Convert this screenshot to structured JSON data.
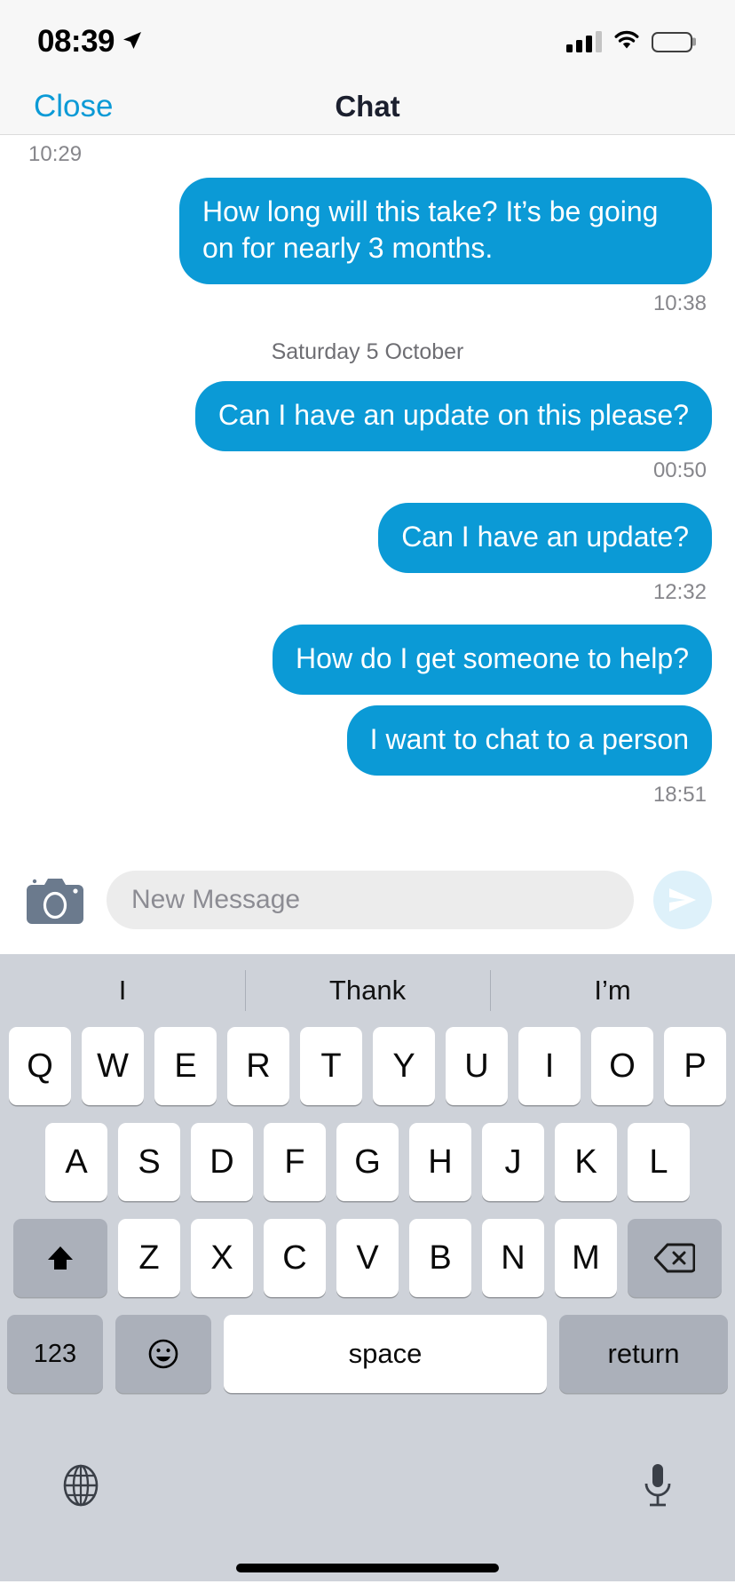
{
  "status_bar": {
    "time": "08:39",
    "location_icon": "location-arrow-icon",
    "signal_icon": "cellular-signal-icon",
    "signal_bars_filled": 3,
    "signal_bars_total": 4,
    "wifi_icon": "wifi-icon",
    "battery_icon": "battery-icon",
    "battery_level": 100
  },
  "nav": {
    "close_label": "Close",
    "title": "Chat"
  },
  "chat": {
    "accent_color": "#0b9ad6",
    "timestamp_color": "#86868b",
    "items": [
      {
        "kind": "timestamp",
        "align": "left",
        "text": "10:29"
      },
      {
        "kind": "message",
        "direction": "outgoing",
        "text": "How long will this take? It’s be going on for nearly 3 months."
      },
      {
        "kind": "timestamp",
        "align": "right",
        "text": "10:38"
      },
      {
        "kind": "day-separator",
        "text": "Saturday 5 October"
      },
      {
        "kind": "message",
        "direction": "outgoing",
        "text": "Can I have an update on this please?"
      },
      {
        "kind": "timestamp",
        "align": "right",
        "text": "00:50"
      },
      {
        "kind": "message",
        "direction": "outgoing",
        "text": "Can I have an update?"
      },
      {
        "kind": "timestamp",
        "align": "right",
        "text": "12:32"
      },
      {
        "kind": "message",
        "direction": "outgoing",
        "text": "How do I get someone to help?"
      },
      {
        "kind": "message",
        "direction": "outgoing",
        "text": "I want to chat to a person"
      },
      {
        "kind": "timestamp",
        "align": "right",
        "text": "18:51"
      }
    ]
  },
  "compose": {
    "camera_icon": "camera-icon",
    "placeholder": "New Message",
    "value": "",
    "send_icon": "send-paper-plane-icon",
    "send_enabled": false
  },
  "keyboard": {
    "predictions": [
      "I",
      "Thank",
      "I’m"
    ],
    "row1": [
      "Q",
      "W",
      "E",
      "R",
      "T",
      "Y",
      "U",
      "I",
      "O",
      "P"
    ],
    "row2": [
      "A",
      "S",
      "D",
      "F",
      "G",
      "H",
      "J",
      "K",
      "L"
    ],
    "row3": [
      "Z",
      "X",
      "C",
      "V",
      "B",
      "N",
      "M"
    ],
    "shift_icon": "shift-up-arrow-icon",
    "backspace_icon": "backspace-delete-icon",
    "numbers_label": "123",
    "emoji_icon": "emoji-smiley-icon",
    "space_label": "space",
    "return_label": "return",
    "globe_icon": "globe-language-icon",
    "mic_icon": "microphone-dictation-icon"
  }
}
